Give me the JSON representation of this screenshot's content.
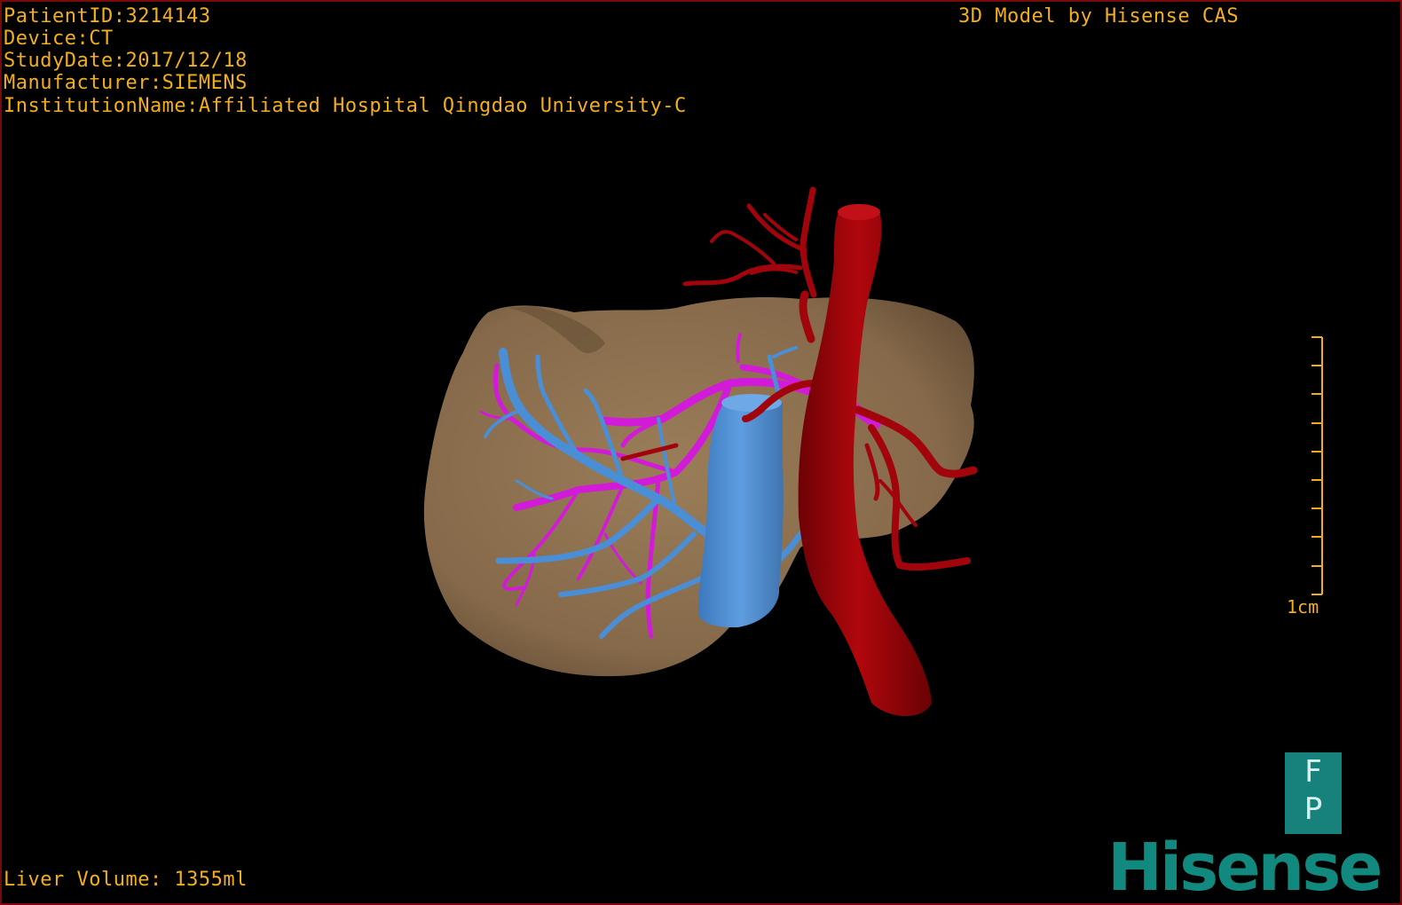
{
  "overlay": {
    "patient_id": "PatientID:3214143",
    "device": "Device:CT",
    "study_date": "StudyDate:2017/12/18",
    "manufacturer": "Manufacturer:SIEMENS",
    "institution": "InstitutionName:Affiliated Hospital Qingdao University-C",
    "model_credit": "3D Model by Hisense CAS",
    "liver_volume": "Liver Volume: 1355ml"
  },
  "scale_bar": {
    "label": "1cm"
  },
  "orientation": {
    "top_letter": "F",
    "bottom_letter": "P"
  },
  "brand": {
    "logo_text": "Hisense"
  },
  "colors": {
    "overlay_text": "#f2ae1c",
    "liver": "#8b6f4c",
    "artery": "#a1050b",
    "hepatic_vein": "#d21bd8",
    "portal_vein": "#4a8ed6",
    "brand": "#11897e",
    "border": "#7a0a0a"
  }
}
